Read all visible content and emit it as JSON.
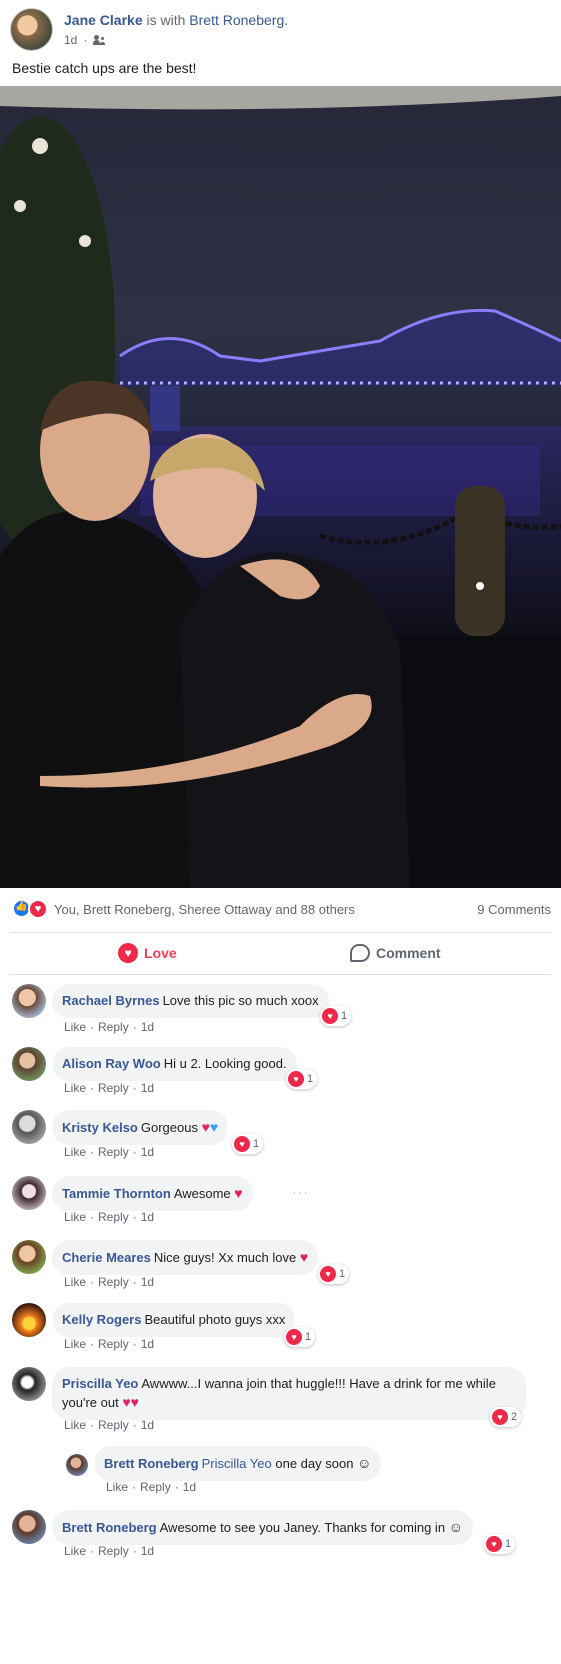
{
  "post": {
    "author": "Jane Clarke",
    "with_text": "is with",
    "tagged": "Brett Roneberg.",
    "time": "1d",
    "caption": "Bestie catch ups are the best!"
  },
  "reactions": {
    "names": "You, Brett Roneberg, Sheree Ottaway and 88 others",
    "comments_count": "9 Comments"
  },
  "actions": {
    "love": "Love",
    "comment": "Comment"
  },
  "meta_labels": {
    "like": "Like",
    "reply": "Reply",
    "sep": "·"
  },
  "comments": [
    {
      "author": "Rachael Byrnes",
      "text": "Love this pic so much xoox",
      "time": "1d",
      "reacts": "1"
    },
    {
      "author": "Alison Ray Woo",
      "text": "Hi u 2. Looking good.",
      "time": "1d",
      "reacts": "1"
    },
    {
      "author": "Kristy Kelso",
      "text": "Gorgeous",
      "time": "1d",
      "reacts": "1"
    },
    {
      "author": "Tammie Thornton",
      "text": "Awesome",
      "time": "1d",
      "reacts": ""
    },
    {
      "author": "Cherie Meares",
      "text": "Nice guys! Xx much love",
      "time": "1d",
      "reacts": "1"
    },
    {
      "author": "Kelly Rogers",
      "text": "Beautiful photo guys xxx",
      "time": "1d",
      "reacts": "1"
    },
    {
      "author": "Priscilla Yeo",
      "text": "Awwww...I wanna join that huggle!!! Have a drink for me while you're out",
      "time": "1d",
      "reacts": "2"
    },
    {
      "author": "Brett Roneberg",
      "mention": "Priscilla Yeo",
      "text": "one day soon",
      "time": "1d",
      "reacts": ""
    },
    {
      "author": "Brett Roneberg",
      "text": "Awesome to see you Janey. Thanks for coming in",
      "time": "1d",
      "reacts": "1"
    }
  ],
  "icons": {
    "friends": "friends-icon",
    "like_reaction": "like-icon",
    "love_reaction": "love-icon",
    "comment": "comment-icon"
  },
  "colors": {
    "link": "#385898",
    "love": "#f33e58",
    "bubble": "#f2f3f5",
    "muted": "#606770"
  }
}
